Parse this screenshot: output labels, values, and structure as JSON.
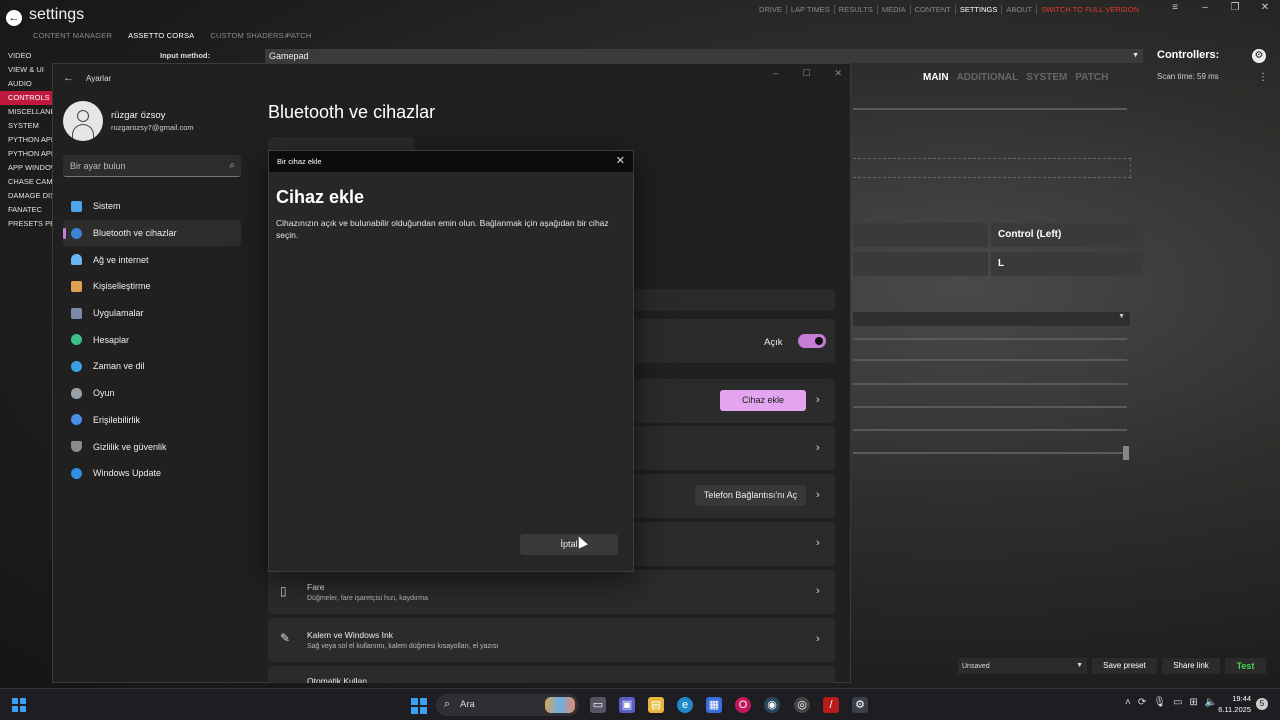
{
  "cm": {
    "title": "settings",
    "tabs": [
      "CONTENT MANAGER",
      "ASSETTO CORSA",
      "CUSTOM SHADERS PATCH"
    ],
    "topnav": [
      "DRIVE",
      "LAP TIMES",
      "RESULTS",
      "MEDIA",
      "CONTENT",
      "SETTINGS",
      "ABOUT",
      "SWITCH TO FULL VERSION"
    ],
    "sidebar": [
      "VIDEO",
      "VIEW & UI",
      "AUDIO",
      "CONTROLS",
      "MISCELLANEOUS",
      "SYSTEM",
      "PYTHON APPS",
      "PYTHON APPS",
      "APP WINDOWS",
      "CHASE CAMERA",
      "DAMAGE DISPLAY",
      "FANATEC",
      "PRESETS PER CAR"
    ],
    "input_method_label": "Input method:",
    "input_method_value": "Gamepad",
    "controllers_title": "Controllers:",
    "scan_time": "Scan time: 59 ms",
    "subtabs": [
      "MAIN",
      "ADDITIONAL",
      "SYSTEM",
      "PATCH"
    ],
    "cell_control_left": "Control (Left)",
    "cell_l": "L",
    "preset_select": "Unsaved",
    "save_preset": "Save preset",
    "share_link": "Share link",
    "test": "Test"
  },
  "settings": {
    "window_title": "Ayarlar",
    "user_name": "rüzgar özsoy",
    "user_email": "ruzgarozsy7@gmail.com",
    "search_placeholder": "Bir ayar bulun",
    "nav": [
      {
        "label": "Sistem",
        "color": "#4aa6e8"
      },
      {
        "label": "Bluetooth ve cihazlar",
        "color": "#3b82d6"
      },
      {
        "label": "Ağ ve internet",
        "color": "#6bb7f0"
      },
      {
        "label": "Kişiselleştirme",
        "color": "#e0a050"
      },
      {
        "label": "Uygulamalar",
        "color": "#7a8aa8"
      },
      {
        "label": "Hesaplar",
        "color": "#3fc08a"
      },
      {
        "label": "Zaman ve dil",
        "color": "#3aa0e0"
      },
      {
        "label": "Oyun",
        "color": "#9aa0a8"
      },
      {
        "label": "Erişilebilirlik",
        "color": "#4a8ee8"
      },
      {
        "label": "Gizlilik ve güvenlik",
        "color": "#8a8a8a"
      },
      {
        "label": "Windows Update",
        "color": "#2f8fe0"
      }
    ],
    "page_title": "Bluetooth ve cihazlar",
    "toggle_label": "Açık",
    "add_device_button": "Cihaz ekle",
    "phone_link_button": "Telefon Bağlantısı'nı Aç",
    "mouse_title": "Fare",
    "mouse_sub": "Düğmeler, fare işaretçisi hızı, kaydırma",
    "pen_title": "Kalem ve Windows Ink",
    "pen_sub": "Sağ veya sol el kullanımı, kalem düğmesi kısayolları, el yazısı",
    "autoplay_title": "Otomatik Kullan"
  },
  "dialog": {
    "title": "Bir cihaz ekle",
    "heading": "Cihaz ekle",
    "description": "Cihazınızın açık ve bulunabilir olduğundan emin olun. Bağlanmak için aşağıdan bir cihaz seçin.",
    "cancel": "İptal"
  },
  "taskbar": {
    "search": "Ara",
    "time": "19:44",
    "date": "6.11.2025",
    "notifications": "5"
  }
}
